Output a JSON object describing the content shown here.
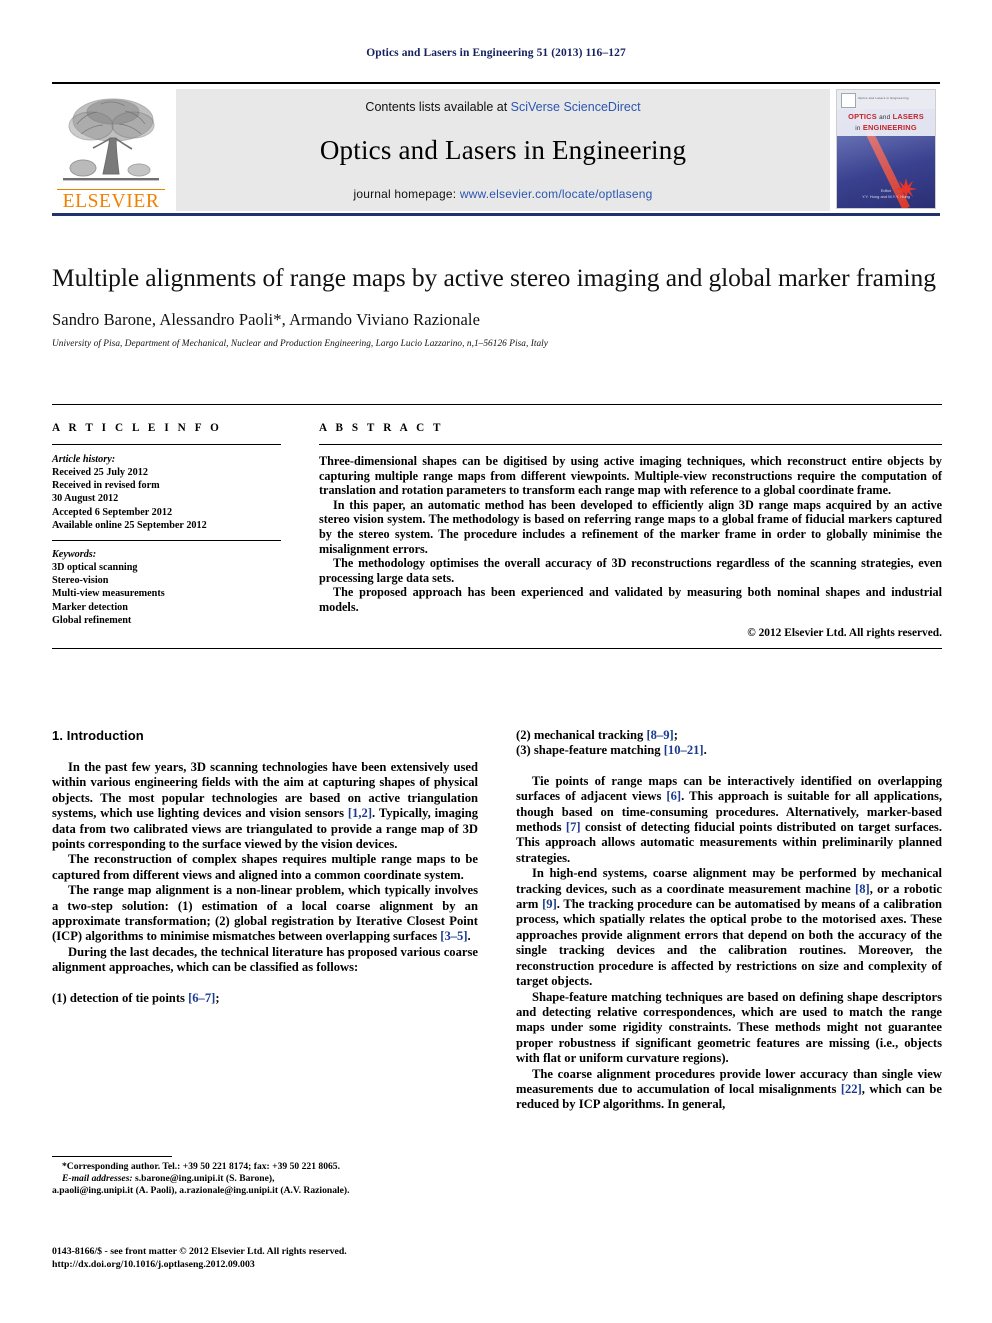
{
  "running_head": "Optics and Lasers in Engineering 51 (2013) 116–127",
  "masthead": {
    "publisher": "ELSEVIER",
    "contents_prefix": "Contents lists available at ",
    "contents_link": "SciVerse ScienceDirect",
    "journal_name": "Optics and Lasers in Engineering",
    "homepage_prefix": "journal homepage: ",
    "homepage_link": "www.elsevier.com/locate/optlaseng",
    "cover": {
      "title_line1_a": "OPTICS",
      "title_line1_b": "and",
      "title_line1_c": "LASERS",
      "title_line2_a": "in",
      "title_line2_b": "ENGINEERING",
      "mini_header": "Optics and Lasers in Engineering",
      "footer_line1": "Editor",
      "footer_line2": "Y.Y. Hung and M.Y.Y. Hung"
    }
  },
  "article": {
    "title": "Multiple alignments of range maps by active stereo imaging and global marker framing",
    "authors": "Sandro Barone, Alessandro Paoli*, Armando Viviano Razionale",
    "affiliation": "University of Pisa, Department of Mechanical, Nuclear and Production Engineering, Largo Lucio Lazzarino, n,1–56126 Pisa, Italy"
  },
  "article_info": {
    "heading": "A R T I C L E  I N F O",
    "history_label": "Article history:",
    "history": [
      "Received 25 July 2012",
      "Received in revised form",
      "30 August 2012",
      "Accepted 6 September 2012",
      "Available online 25 September 2012"
    ],
    "keywords_label": "Keywords:",
    "keywords": [
      "3D optical scanning",
      "Stereo-vision",
      "Multi-view measurements",
      "Marker detection",
      "Global refinement"
    ]
  },
  "abstract": {
    "heading": "A B S T R A C T",
    "paragraphs": [
      "Three-dimensional shapes can be digitised by using active imaging techniques, which reconstruct entire objects by capturing multiple range maps from different viewpoints. Multiple-view reconstructions require the computation of translation and rotation parameters to transform each range map with reference to a global coordinate frame.",
      "In this paper, an automatic method has been developed to efficiently align 3D range maps acquired by an active stereo vision system. The methodology is based on referring range maps to a global frame of fiducial markers captured by the stereo system. The procedure includes a refinement of the marker frame in order to globally minimise the misalignment errors.",
      "The methodology optimises the overall accuracy of 3D reconstructions regardless of the scanning strategies, even processing large data sets.",
      "The proposed approach has been experienced and validated by measuring both nominal shapes and industrial models."
    ],
    "copyright": "© 2012 Elsevier Ltd. All rights reserved."
  },
  "body": {
    "section_title": "1.  Introduction",
    "left_paragraphs": [
      "In the past few years, 3D scanning technologies have been extensively used within various engineering fields with the aim at capturing shapes of physical objects. The most popular technologies are based on active triangulation systems, which use lighting devices and vision sensors [1,2]. Typically, imaging data from two calibrated views are triangulated to provide a range map of 3D points corresponding to the surface viewed by the vision devices.",
      "The reconstruction of complex shapes requires multiple range maps to be captured from different views and aligned into a common coordinate system.",
      "The range map alignment is a non-linear problem, which typically involves a two-step solution: (1) estimation of a local coarse alignment by an approximate transformation; (2) global registration by Iterative Closest Point (ICP) algorithms to minimise mismatches between overlapping surfaces [3–5].",
      "During the last decades, the technical literature has proposed various coarse alignment approaches, which can be classified as follows:"
    ],
    "list_left": [
      "(1) detection of tie points [6–7];"
    ],
    "list_right": [
      "(2) mechanical tracking [8–9];",
      "(3) shape-feature matching [10–21]."
    ],
    "right_paragraphs": [
      "Tie points of range maps can be interactively identified on overlapping surfaces of adjacent views [6]. This approach is suitable for all applications, though based on time-consuming procedures. Alternatively, marker-based methods [7] consist of detecting fiducial points distributed on target surfaces. This approach allows automatic measurements within preliminarily planned strategies.",
      "In high-end systems, coarse alignment may be performed by mechanical tracking devices, such as a coordinate measurement machine [8], or a robotic arm [9]. The tracking procedure can be automatised by means of a calibration process, which spatially relates the optical probe to the motorised axes. These approaches provide alignment errors that depend on both the accuracy of the single tracking devices and the calibration routines. Moreover, the reconstruction procedure is affected by restrictions on size and complexity of target objects.",
      "Shape-feature matching techniques are based on defining shape descriptors and detecting relative correspondences, which are used to match the range maps under some rigidity constraints. These methods might not guarantee proper robustness if significant geometric features are missing (i.e., objects with flat or uniform curvature regions).",
      "The coarse alignment procedures provide lower accuracy than single view measurements due to accumulation of local misalignments [22], which can be reduced by ICP algorithms. In general,"
    ]
  },
  "footnotes": {
    "corresponding": "*Corresponding author. Tel.: +39 50 221 8174; fax: +39 50 221 8065.",
    "email_label": "E-mail addresses:",
    "email_line1": " s.barone@ing.unipi.it (S. Barone),",
    "email_line2": "a.paoli@ing.unipi.it (A. Paoli), a.razionale@ing.unipi.it (A.V. Razionale).",
    "imprint_line1": "0143-8166/$ - see front matter © 2012 Elsevier Ltd. All rights reserved.",
    "imprint_line2": "http://dx.doi.org/10.1016/j.optlaseng.2012.09.003"
  },
  "colors": {
    "running_head": "#16205e",
    "link": "#2b56b0",
    "reference": "#1a3a8f",
    "elsevier_orange": "#F08000",
    "masthead_rule": "#22326e"
  }
}
